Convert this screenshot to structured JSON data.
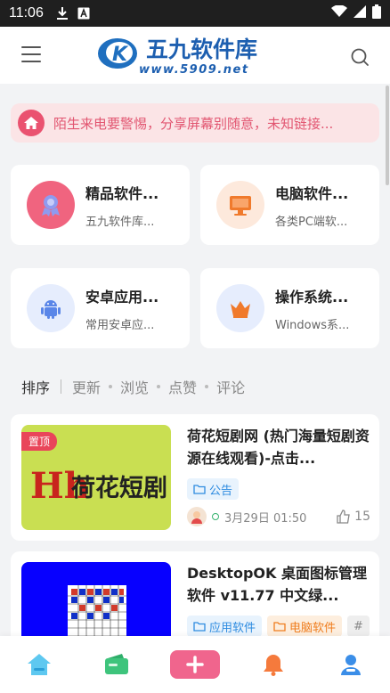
{
  "status_bar": {
    "time": "11:06"
  },
  "header": {
    "logo_cn": "五九软件库",
    "logo_url": "www.5909.net",
    "logo_letter": "K"
  },
  "notice": {
    "text": "陌生来电要警惕，分享屏幕别随意，未知链接..."
  },
  "categories": [
    {
      "title": "精品软件...",
      "desc": "五九软件库...",
      "icon": "badge-icon",
      "color": "#f0647f"
    },
    {
      "title": "电脑软件...",
      "desc": "各类PC端软...",
      "icon": "monitor-icon",
      "color": "#f07a2c"
    },
    {
      "title": "安卓应用...",
      "desc": "常用安卓应...",
      "icon": "android-icon",
      "color": "#5a86e8"
    },
    {
      "title": "操作系统...",
      "desc": "Windows系...",
      "icon": "crown-icon",
      "color": "#f07a2c"
    }
  ],
  "sort": {
    "active": "排序",
    "options": [
      "更新",
      "浏览",
      "点赞",
      "评论"
    ]
  },
  "posts": [
    {
      "title": "荷花短剧网 (热门海量短剧资源在线观看)-点击...",
      "pin_label": "置顶",
      "thumb_text": "荷花短剧",
      "thumb_logo": "Hh",
      "tags": [
        {
          "label": "公告",
          "style": "blue"
        }
      ],
      "date": "3月29日 01:50",
      "likes": "15"
    },
    {
      "title": "DesktopOK 桌面图标管理软件 v11.77 中文绿...",
      "tags": [
        {
          "label": "应用软件",
          "style": "blue"
        },
        {
          "label": "电脑软件",
          "style": "orange"
        },
        {
          "label": "#",
          "style": "gray"
        }
      ]
    }
  ],
  "tabbar": {
    "items": [
      "home-icon",
      "wallet-icon",
      "plus-icon",
      "bell-icon",
      "user-icon"
    ]
  }
}
